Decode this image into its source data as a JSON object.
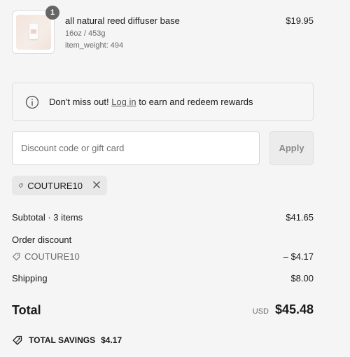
{
  "line_item": {
    "quantity": "1",
    "name": "all natural reed diffuser base",
    "variant": "16oz / 453g",
    "weight": "item_weight: 494",
    "price": "$19.95"
  },
  "rewards_banner": {
    "prefix": "Don't miss out! ",
    "link": "Log in",
    "suffix": " to earn and redeem rewards"
  },
  "discount": {
    "placeholder": "Discount code or gift card",
    "apply_label": "Apply",
    "applied_code": "COUTURE10"
  },
  "summary": {
    "subtotal_label": "Subtotal · 3 items",
    "subtotal_value": "$41.65",
    "order_discount_label": "Order discount",
    "discount_code": "COUTURE10",
    "discount_value": "– $4.17",
    "shipping_label": "Shipping",
    "shipping_value": "$8.00",
    "total_label": "Total",
    "currency": "USD",
    "total_value": "$45.48",
    "savings_label": "TOTAL SAVINGS",
    "savings_value": "$4.17"
  },
  "colors": {
    "background": "#f5f5f5",
    "text": "#1a1a1a",
    "muted": "#6b6b6b",
    "badge": "#666666"
  },
  "icons": {
    "info": "info-icon",
    "tag": "tag-icon",
    "close": "close-icon"
  }
}
